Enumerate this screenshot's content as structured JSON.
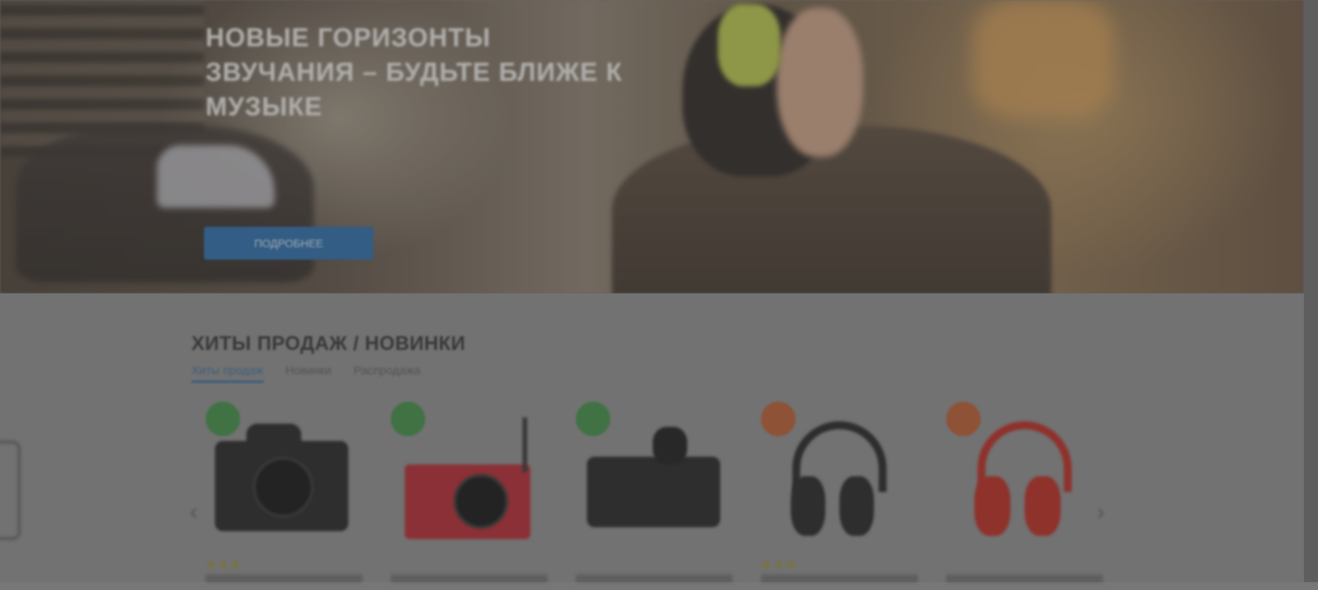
{
  "hero": {
    "title": "НОВЫЕ ГОРИЗОНТЫ ЗВУЧАНИЯ – БУДЬТЕ БЛИЖЕ К МУЗЫКЕ",
    "button_label": "ПОДРОБНЕЕ"
  },
  "section": {
    "title": "ХИТЫ ПРОДАЖ / НОВИНКИ",
    "tabs": [
      "Хиты продаж",
      "Новинки",
      "Распродажа"
    ]
  },
  "products": [
    {
      "badge_color": "#3f8a44",
      "kind": "dslr-camera",
      "rating": "★★★"
    },
    {
      "badge_color": "#3f8a44",
      "kind": "red-compact-camera",
      "rating": ""
    },
    {
      "badge_color": "#3f8a44",
      "kind": "mirrorless-camera",
      "rating": ""
    },
    {
      "badge_color": "#b55a31",
      "kind": "black-headphones",
      "rating": "★★★"
    },
    {
      "badge_color": "#b55a31",
      "kind": "red-headphones",
      "rating": ""
    }
  ],
  "icons": {
    "prev": "chevron-left-icon",
    "next": "chevron-right-icon"
  },
  "colors": {
    "accent": "#3a6d9c",
    "button": "#2a6aa6",
    "badge_new": "#3f8a44",
    "badge_sale": "#b55a31"
  }
}
